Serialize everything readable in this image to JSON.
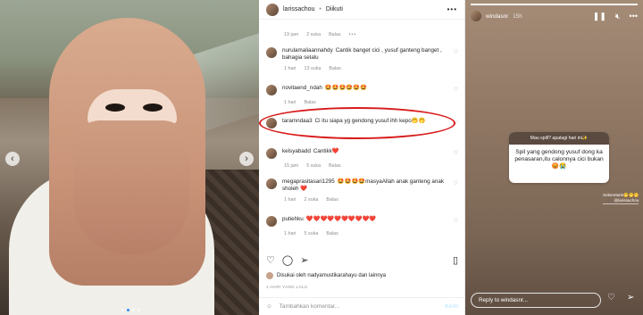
{
  "post": {
    "username": "larissachou",
    "separator": "•",
    "follow_label": "Diikuti",
    "top_meta": {
      "time": "19 jam",
      "likes": "2 suka",
      "reply": "Balas"
    }
  },
  "comments": [
    {
      "user": "nurulamaliaannahdy",
      "text": "Cantik banget cici , yusuf ganteng banget , bahagia selalu",
      "time": "1 hari",
      "likes": "13 suka",
      "reply": "Balas"
    },
    {
      "user": "novitaend_ndah",
      "text": "🤩🤩🤩🤩🤩🤩",
      "time": "1 hari",
      "likes": "",
      "reply": "Balas"
    },
    {
      "user": "taramndaa3",
      "text": "Ci itu siapa yg gendong yusuf ihh kepo🤭🤭",
      "time": "",
      "likes": "",
      "reply": ""
    },
    {
      "user": "kelsyabadd",
      "text": "Cantikk❤️",
      "time": "15 jam",
      "likes": "5 suka",
      "reply": "Balas"
    },
    {
      "user": "megaprasitasari1295",
      "text": "🤩🤩🤩🤩masyaAllah anak ganteng anak sholeh ❤️",
      "time": "1 hari",
      "likes": "2 suka",
      "reply": "Balas"
    },
    {
      "user": "putiehku",
      "text": "❤️❤️❤️❤️❤️❤️❤️❤️❤️❤️",
      "time": "1 hari",
      "likes": "5 suka",
      "reply": "Balas"
    }
  ],
  "liked_by": "Disukai oleh nadyamustikarahayu dan lainnya",
  "time_ago": "1 HARI YANG LALU",
  "add_comment": {
    "placeholder": "Tambahkan komentar...",
    "post_label": "Kirim"
  },
  "story": {
    "username": "windasnr",
    "time": "15h",
    "question": "Mau spill? apalagi hari ini✨",
    "answer": "Spil yang gendong yusuf dong ka penasaran,itu calonnya cici bukan😡😭",
    "caption_text": "Sekeretaris🤭🤭🤭",
    "caption_handle": "@larissachou",
    "reply_placeholder": "Reply to windasnr..."
  }
}
